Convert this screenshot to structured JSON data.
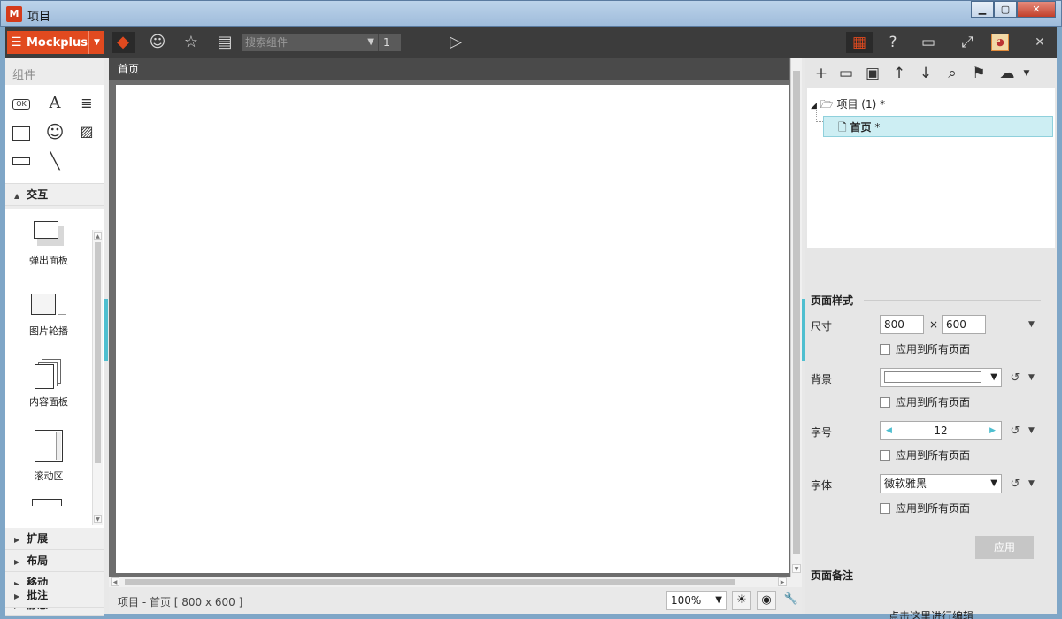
{
  "window": {
    "title": "项目",
    "app_icon_letter": "M"
  },
  "toolbar": {
    "brand": "Mockplus",
    "search_placeholder": "搜索组件",
    "page_number": "1"
  },
  "left_panel": {
    "title": "组件",
    "basic_ok_label": "OK",
    "basic_text_label": "A",
    "interact_section": "交互",
    "components": [
      {
        "label": "弹出面板"
      },
      {
        "label": "图片轮播"
      },
      {
        "label": "内容面板"
      },
      {
        "label": "滚动区"
      }
    ],
    "sections": [
      "扩展",
      "布局",
      "移动",
      "静态",
      "批注"
    ]
  },
  "canvas": {
    "page_title": "首页",
    "status": "项目 - 首页 [ 800 x 600 ]",
    "zoom": "100%"
  },
  "right_panel": {
    "tree": {
      "project": "项目 (1)",
      "page": "首页",
      "marker": "*"
    },
    "page_style_title": "页面样式",
    "size_label": "尺寸",
    "width": "800",
    "height": "600",
    "times": "×",
    "apply_all": "应用到所有页面",
    "bg_label": "背景",
    "fontsize_label": "字号",
    "fontsize_value": "12",
    "font_label": "字体",
    "font_value": "微软雅黑",
    "apply_button": "应用",
    "notes_title": "页面备注",
    "notes_placeholder": "点击这里进行编辑"
  },
  "colors": {
    "brand": "#e14a1f",
    "accent": "#4fbfd0",
    "selected": "#cdeef3"
  }
}
